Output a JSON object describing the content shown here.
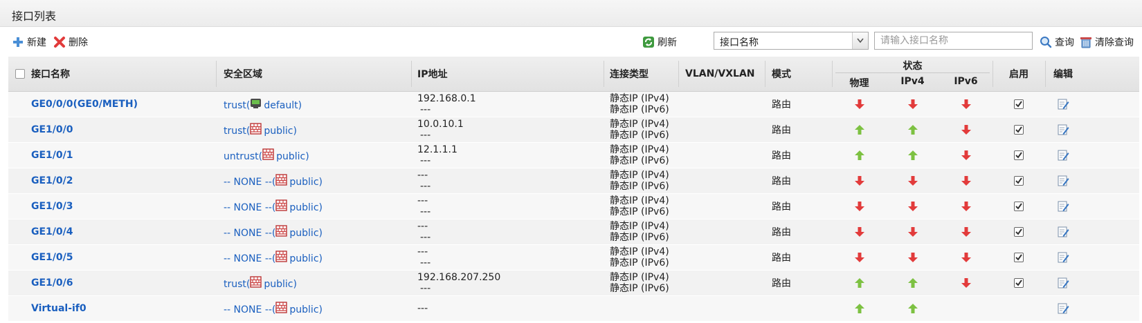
{
  "panel": {
    "title": "接口列表"
  },
  "toolbar": {
    "new_label": "新建",
    "delete_label": "删除",
    "refresh_label": "刷新",
    "filter_select_value": "接口名称",
    "search_placeholder": "请输入接口名称",
    "query_label": "查询",
    "clear_query_label": "清除查询"
  },
  "table": {
    "headers": {
      "name": "接口名称",
      "zone": "安全区域",
      "ip": "IP地址",
      "conn": "连接类型",
      "vlan": "VLAN/VXLAN",
      "mode": "模式",
      "status": "状态",
      "physical": "物理",
      "ipv4": "IPv4",
      "ipv6": "IPv6",
      "enable": "启用",
      "edit": "编辑"
    },
    "rows": [
      {
        "name": "GE0/0/0(GE0/METH)",
        "zone": "trust(",
        "vsys": "default)",
        "vsys_icon": "vsys-green-icon",
        "ip1": "192.168.0.1",
        "ip2": "---",
        "conn1": "静态IP (IPv4)",
        "conn2": "静态IP (IPv6)",
        "mode": "路由",
        "phy": "down",
        "v4": "down",
        "v6": "down",
        "enabled": true
      },
      {
        "name": "GE1/0/0",
        "zone": "trust(",
        "vsys": "public)",
        "vsys_icon": "firewall-icon",
        "ip1": "10.0.10.1",
        "ip2": "---",
        "conn1": "静态IP (IPv4)",
        "conn2": "静态IP (IPv6)",
        "mode": "路由",
        "phy": "up",
        "v4": "up",
        "v6": "down",
        "enabled": true
      },
      {
        "name": "GE1/0/1",
        "zone": "untrust(",
        "vsys": "public)",
        "vsys_icon": "firewall-icon",
        "ip1": "12.1.1.1",
        "ip2": "---",
        "conn1": "静态IP (IPv4)",
        "conn2": "静态IP (IPv6)",
        "mode": "路由",
        "phy": "up",
        "v4": "up",
        "v6": "down",
        "enabled": true
      },
      {
        "name": "GE1/0/2",
        "zone": "-- NONE --(",
        "vsys": "public)",
        "vsys_icon": "firewall-icon",
        "ip1": "---",
        "ip2": "---",
        "conn1": "静态IP (IPv4)",
        "conn2": "静态IP (IPv6)",
        "mode": "路由",
        "phy": "down",
        "v4": "down",
        "v6": "down",
        "enabled": true
      },
      {
        "name": "GE1/0/3",
        "zone": "-- NONE --(",
        "vsys": "public)",
        "vsys_icon": "firewall-icon",
        "ip1": "---",
        "ip2": "---",
        "conn1": "静态IP (IPv4)",
        "conn2": "静态IP (IPv6)",
        "mode": "路由",
        "phy": "down",
        "v4": "down",
        "v6": "down",
        "enabled": true
      },
      {
        "name": "GE1/0/4",
        "zone": "-- NONE --(",
        "vsys": "public)",
        "vsys_icon": "firewall-icon",
        "ip1": "---",
        "ip2": "---",
        "conn1": "静态IP (IPv4)",
        "conn2": "静态IP (IPv6)",
        "mode": "路由",
        "phy": "down",
        "v4": "down",
        "v6": "down",
        "enabled": true
      },
      {
        "name": "GE1/0/5",
        "zone": "-- NONE --(",
        "vsys": "public)",
        "vsys_icon": "firewall-icon",
        "ip1": "---",
        "ip2": "---",
        "conn1": "静态IP (IPv4)",
        "conn2": "静态IP (IPv6)",
        "mode": "路由",
        "phy": "down",
        "v4": "down",
        "v6": "down",
        "enabled": true
      },
      {
        "name": "GE1/0/6",
        "zone": "trust(",
        "vsys": "public)",
        "vsys_icon": "firewall-icon",
        "ip1": "192.168.207.250",
        "ip2": "---",
        "conn1": "静态IP (IPv4)",
        "conn2": "静态IP (IPv6)",
        "mode": "路由",
        "phy": "up",
        "v4": "up",
        "v6": "down",
        "enabled": true
      },
      {
        "name": "Virtual-if0",
        "zone": "-- NONE --(",
        "vsys": "public)",
        "vsys_icon": "firewall-icon",
        "ip1": "---",
        "ip2": "",
        "conn1": "",
        "conn2": "",
        "mode": "",
        "phy": "up",
        "v4": "up",
        "v6": "",
        "enabled": null
      }
    ]
  },
  "colors": {
    "link": "#1a5fbf",
    "up": "#7dc142",
    "down": "#e23b3b"
  }
}
